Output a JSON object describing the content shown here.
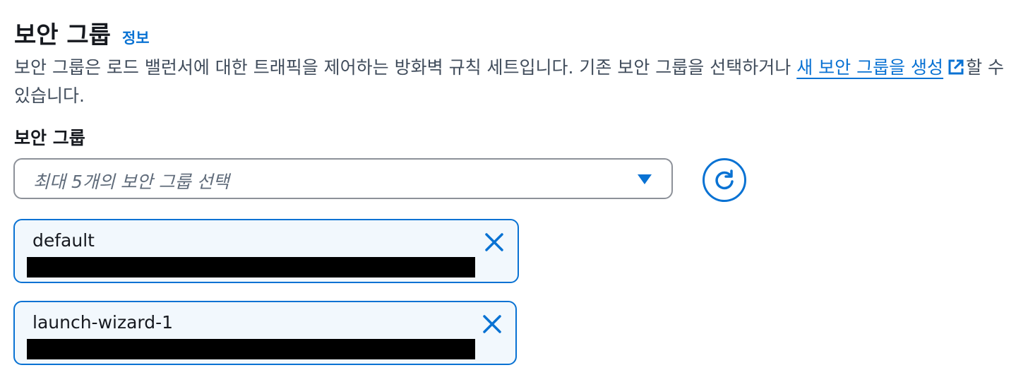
{
  "header": {
    "title": "보안 그룹",
    "info_label": "정보"
  },
  "description": {
    "text": "보안 그룹은 로드 밸런서에 대한 트래픽을 제어하는 방화벽 규칙 세트입니다. 기존 보안 그룹을 선택하거나 ",
    "link_text": "새 보안 그룹을 생성",
    "link_icon": "external-link-icon",
    "suffix": "할 수 있습니다."
  },
  "field": {
    "label": "보안 그룹",
    "placeholder": "최대 5개의 보안 그룹 선택",
    "dropdown_icon": "caret-down-icon",
    "refresh_icon": "refresh-icon"
  },
  "selected_groups": [
    {
      "name": "default",
      "remove_icon": "close-icon"
    },
    {
      "name": "launch-wizard-1",
      "remove_icon": "close-icon"
    }
  ],
  "colors": {
    "accent": "#0972d3",
    "token_background": "#f2f8fd",
    "text": "#16191f",
    "secondary_text": "#414d5c",
    "placeholder": "#5f6b7a",
    "input_border": "#8d9199",
    "redaction": "#000000"
  }
}
